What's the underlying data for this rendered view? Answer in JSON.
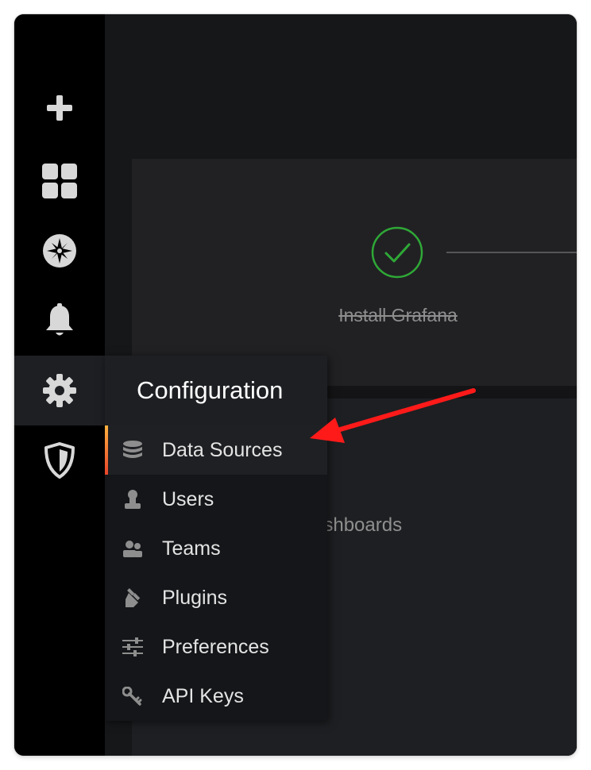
{
  "sidemenu": {
    "items": [
      {
        "icon": "plus-icon",
        "label": "Create"
      },
      {
        "icon": "dashboards-icon",
        "label": "Dashboards"
      },
      {
        "icon": "explore-compass-icon",
        "label": "Explore"
      },
      {
        "icon": "alerting-bell-icon",
        "label": "Alerting"
      },
      {
        "icon": "gear-icon",
        "label": "Configuration",
        "active": true
      },
      {
        "icon": "shield-icon",
        "label": "Server Admin"
      }
    ]
  },
  "onboarding": {
    "step1_label": "Install Grafana",
    "step1_status": "done",
    "partial_text_1": "s",
    "partial_text_2": "ashboards"
  },
  "config_menu": {
    "title": "Configuration",
    "items": [
      {
        "label": "Data Sources",
        "icon": "database-icon",
        "active": true
      },
      {
        "label": "Users",
        "icon": "user-icon"
      },
      {
        "label": "Teams",
        "icon": "users-icon"
      },
      {
        "label": "Plugins",
        "icon": "plug-icon"
      },
      {
        "label": "Preferences",
        "icon": "sliders-icon"
      },
      {
        "label": "API Keys",
        "icon": "key-icon"
      }
    ]
  },
  "colors": {
    "success": "#2fa836",
    "accent_top": "#ffb23f",
    "accent_bottom": "#e9442b",
    "annotation_arrow": "#ff1a1a"
  }
}
